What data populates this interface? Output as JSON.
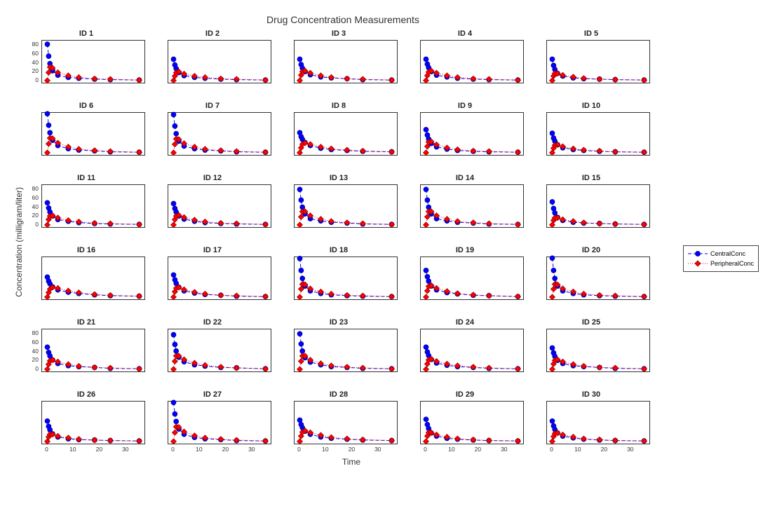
{
  "title": "Drug Concentration Measurements",
  "xlabel": "Time",
  "ylabel": "Concentration (milligram/liter)",
  "legend": {
    "series1": "CentralConc",
    "series2": "PeripheralConc"
  },
  "chart_data": {
    "type": "line",
    "layout": {
      "rows": 6,
      "cols": 5
    },
    "xlim": [
      -2,
      37
    ],
    "ylim": [
      -5,
      90
    ],
    "xticks": [
      0,
      10,
      20,
      30
    ],
    "yticks": [
      0,
      20,
      40,
      60,
      80
    ],
    "xticks_visible_rows": [
      5
    ],
    "yticks_visible_cols": [
      0
    ],
    "yticks_visible_rows": [
      0,
      2,
      4
    ],
    "x": [
      0,
      0.5,
      1,
      2,
      4,
      8,
      12,
      18,
      24,
      35
    ],
    "series_names": [
      "CentralConc",
      "PeripheralConc"
    ],
    "series_colors": [
      "#0000ff",
      "#ff0000"
    ],
    "series_markers": [
      "circle",
      "diamond"
    ],
    "series_linestyles": [
      "dash",
      "dot"
    ],
    "panels": [
      {
        "id": 1,
        "central": [
          82,
          55,
          38,
          22,
          12,
          7,
          5,
          3,
          2,
          1
        ],
        "peripheral": [
          0,
          18,
          30,
          28,
          18,
          11,
          7,
          4,
          3,
          1
        ]
      },
      {
        "id": 2,
        "central": [
          48,
          35,
          27,
          18,
          11,
          7,
          5,
          3,
          2,
          1
        ],
        "peripheral": [
          0,
          10,
          18,
          20,
          15,
          10,
          7,
          4,
          3,
          1
        ]
      },
      {
        "id": 3,
        "central": [
          48,
          36,
          28,
          20,
          13,
          8,
          6,
          4,
          2,
          1
        ],
        "peripheral": [
          0,
          12,
          20,
          22,
          17,
          11,
          7,
          4,
          3,
          1
        ]
      },
      {
        "id": 4,
        "central": [
          48,
          37,
          29,
          20,
          12,
          8,
          5,
          3,
          2,
          1
        ],
        "peripheral": [
          0,
          11,
          19,
          22,
          17,
          11,
          7,
          4,
          3,
          1
        ]
      },
      {
        "id": 5,
        "central": [
          48,
          34,
          25,
          16,
          10,
          6,
          4,
          3,
          2,
          1
        ],
        "peripheral": [
          0,
          10,
          16,
          16,
          12,
          8,
          5,
          3,
          2,
          1
        ]
      },
      {
        "id": 6,
        "central": [
          88,
          62,
          45,
          28,
          16,
          9,
          6,
          4,
          2,
          1
        ],
        "peripheral": [
          0,
          20,
          33,
          32,
          22,
          13,
          8,
          5,
          3,
          1
        ]
      },
      {
        "id": 7,
        "central": [
          86,
          60,
          43,
          26,
          15,
          9,
          6,
          4,
          2,
          1
        ],
        "peripheral": [
          0,
          19,
          31,
          30,
          21,
          13,
          8,
          5,
          3,
          1
        ]
      },
      {
        "id": 8,
        "central": [
          45,
          36,
          30,
          23,
          16,
          10,
          7,
          5,
          3,
          2
        ],
        "peripheral": [
          0,
          11,
          19,
          22,
          19,
          13,
          9,
          6,
          4,
          2
        ]
      },
      {
        "id": 9,
        "central": [
          52,
          40,
          31,
          21,
          13,
          8,
          5,
          3,
          2,
          1
        ],
        "peripheral": [
          0,
          14,
          24,
          25,
          18,
          11,
          7,
          4,
          3,
          1
        ]
      },
      {
        "id": 10,
        "central": [
          44,
          33,
          26,
          18,
          11,
          7,
          5,
          3,
          2,
          1
        ],
        "peripheral": [
          0,
          10,
          17,
          18,
          14,
          9,
          6,
          4,
          2,
          1
        ]
      },
      {
        "id": 11,
        "central": [
          50,
          38,
          29,
          20,
          12,
          8,
          5,
          3,
          2,
          1
        ],
        "peripheral": [
          0,
          12,
          20,
          21,
          16,
          10,
          7,
          4,
          3,
          1
        ]
      },
      {
        "id": 12,
        "central": [
          48,
          37,
          29,
          20,
          13,
          8,
          5,
          3,
          2,
          1
        ],
        "peripheral": [
          0,
          12,
          20,
          22,
          17,
          11,
          7,
          4,
          3,
          1
        ]
      },
      {
        "id": 13,
        "central": [
          80,
          56,
          40,
          25,
          14,
          9,
          6,
          4,
          2,
          1
        ],
        "peripheral": [
          0,
          18,
          30,
          30,
          21,
          13,
          8,
          5,
          3,
          1
        ]
      },
      {
        "id": 14,
        "central": [
          80,
          56,
          40,
          25,
          14,
          9,
          6,
          4,
          2,
          1
        ],
        "peripheral": [
          0,
          18,
          30,
          30,
          21,
          13,
          8,
          5,
          3,
          1
        ]
      },
      {
        "id": 15,
        "central": [
          52,
          37,
          27,
          17,
          10,
          6,
          4,
          3,
          2,
          1
        ],
        "peripheral": [
          0,
          10,
          16,
          16,
          12,
          8,
          5,
          3,
          2,
          1
        ]
      },
      {
        "id": 16,
        "central": [
          45,
          36,
          30,
          23,
          16,
          11,
          8,
          5,
          3,
          2
        ],
        "peripheral": [
          0,
          10,
          18,
          22,
          20,
          14,
          10,
          6,
          4,
          2
        ]
      },
      {
        "id": 17,
        "central": [
          50,
          39,
          31,
          22,
          14,
          9,
          6,
          4,
          2,
          1
        ],
        "peripheral": [
          0,
          12,
          20,
          22,
          17,
          11,
          7,
          4,
          3,
          1
        ]
      },
      {
        "id": 18,
        "central": [
          87,
          60,
          42,
          25,
          14,
          8,
          5,
          3,
          2,
          1
        ],
        "peripheral": [
          0,
          18,
          29,
          28,
          19,
          12,
          7,
          4,
          3,
          1
        ]
      },
      {
        "id": 19,
        "central": [
          60,
          46,
          36,
          25,
          16,
          10,
          7,
          4,
          3,
          1
        ],
        "peripheral": [
          0,
          14,
          24,
          26,
          20,
          13,
          8,
          5,
          3,
          1
        ]
      },
      {
        "id": 20,
        "central": [
          88,
          60,
          42,
          25,
          14,
          8,
          5,
          3,
          2,
          1
        ],
        "peripheral": [
          0,
          18,
          29,
          28,
          19,
          12,
          7,
          4,
          3,
          1
        ]
      },
      {
        "id": 21,
        "central": [
          50,
          38,
          30,
          21,
          13,
          8,
          6,
          4,
          2,
          1
        ],
        "peripheral": [
          0,
          11,
          19,
          21,
          17,
          11,
          7,
          4,
          3,
          1
        ]
      },
      {
        "id": 22,
        "central": [
          78,
          56,
          41,
          27,
          17,
          10,
          7,
          4,
          3,
          1
        ],
        "peripheral": [
          0,
          18,
          30,
          30,
          22,
          14,
          9,
          5,
          3,
          1
        ]
      },
      {
        "id": 23,
        "central": [
          80,
          57,
          41,
          26,
          16,
          10,
          6,
          4,
          2,
          1
        ],
        "peripheral": [
          0,
          18,
          30,
          30,
          21,
          13,
          8,
          5,
          3,
          1
        ]
      },
      {
        "id": 24,
        "central": [
          50,
          39,
          31,
          22,
          14,
          9,
          6,
          4,
          2,
          1
        ],
        "peripheral": [
          0,
          12,
          21,
          23,
          18,
          12,
          8,
          5,
          3,
          1
        ]
      },
      {
        "id": 25,
        "central": [
          48,
          37,
          29,
          20,
          13,
          8,
          6,
          4,
          2,
          1
        ],
        "peripheral": [
          0,
          12,
          20,
          22,
          17,
          11,
          7,
          4,
          3,
          1
        ]
      },
      {
        "id": 26,
        "central": [
          46,
          34,
          26,
          17,
          10,
          6,
          4,
          3,
          2,
          1
        ],
        "peripheral": [
          0,
          10,
          16,
          16,
          12,
          8,
          5,
          3,
          2,
          1
        ]
      },
      {
        "id": 27,
        "central": [
          88,
          62,
          45,
          28,
          16,
          9,
          6,
          4,
          2,
          1
        ],
        "peripheral": [
          0,
          20,
          33,
          32,
          22,
          13,
          8,
          5,
          3,
          1
        ]
      },
      {
        "id": 28,
        "central": [
          48,
          38,
          31,
          23,
          16,
          10,
          7,
          5,
          3,
          2
        ],
        "peripheral": [
          0,
          12,
          21,
          24,
          20,
          14,
          9,
          6,
          4,
          2
        ]
      },
      {
        "id": 29,
        "central": [
          50,
          38,
          29,
          19,
          12,
          7,
          5,
          3,
          2,
          1
        ],
        "peripheral": [
          0,
          12,
          20,
          20,
          15,
          10,
          6,
          4,
          2,
          1
        ]
      },
      {
        "id": 30,
        "central": [
          46,
          35,
          27,
          19,
          12,
          8,
          5,
          3,
          2,
          1
        ],
        "peripheral": [
          0,
          11,
          18,
          19,
          15,
          10,
          6,
          4,
          2,
          1
        ]
      }
    ]
  }
}
